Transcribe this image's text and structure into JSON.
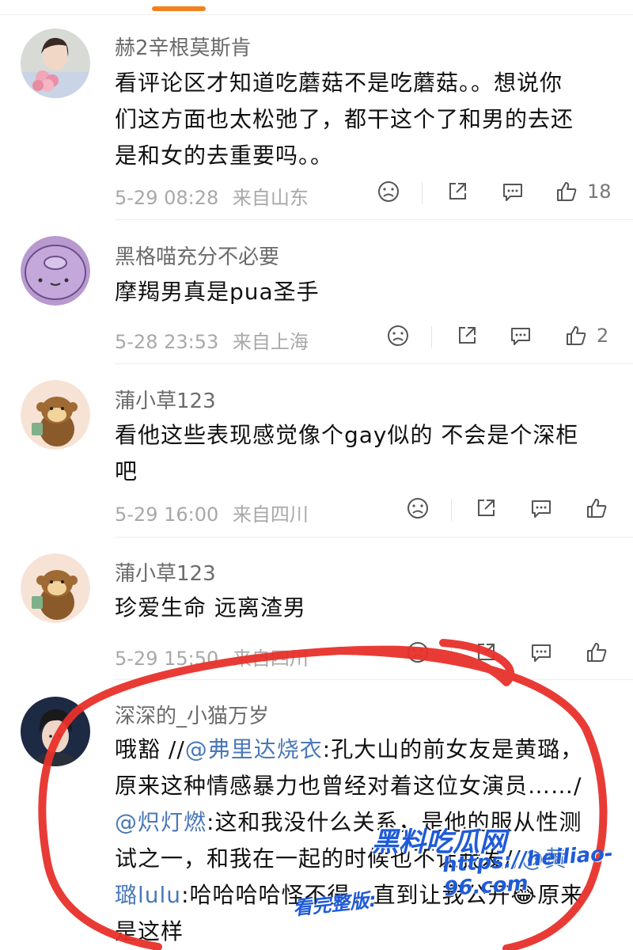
{
  "comments": [
    {
      "username": "赫2辛根莫斯肯",
      "text_lines": [
        "看评论区才知道吃蘑菇不是吃蘑菇。。想说你",
        "们这方面也太松弛了，都干这个了和男的去还",
        "是和女的去重要吗。。"
      ],
      "time": "5-29 08:28",
      "location": "来自山东",
      "likes": "18"
    },
    {
      "username": "黑格喵充分不必要",
      "text_lines": [
        "摩羯男真是pua圣手"
      ],
      "time": "5-28 23:53",
      "location": "来自上海",
      "likes": "2"
    },
    {
      "username": "蒲小草123",
      "text_lines": [
        "看他这些表现感觉像个gay似的 不会是个深柜",
        "吧"
      ],
      "time": "5-29 16:00",
      "location": "来自四川",
      "likes": ""
    },
    {
      "username": "蒲小草123",
      "text_lines": [
        "珍爱生命 远离渣男"
      ],
      "time": "5-29 15:50",
      "location": "来自四川",
      "likes": ""
    },
    {
      "username": "深深的_小猫万岁",
      "line1": {
        "a": "哦豁 //",
        "mention": "@弗里达烧衣",
        "b": ":孔大山的前女友是黄璐，"
      },
      "line2": "原来这种情感暴力也曾经对着这位女演员……/",
      "line3": {
        "mention": "@炽灯燃",
        "b": ":这和我没什么关系，是他的服从性测"
      },
      "line4": {
        "a": "试之一，和我在一起的时候也不让我发//",
        "mention": "@黄"
      },
      "line5": {
        "mention": "璐lulu",
        "b": ":哈哈哈哈怪不得，直到让我公开",
        "emoji": "😂",
        "c": "原来"
      },
      "line6": "是这样"
    }
  ],
  "watermark": {
    "brand": "黑料吃瓜网",
    "url": "https://heiliao-96.com",
    "note": "看完整版:"
  },
  "colors": {
    "accent_tab": "#f2821e",
    "mention": "#4a78b9",
    "annotation": "#e8302a",
    "watermark": "#1f5bd8"
  }
}
